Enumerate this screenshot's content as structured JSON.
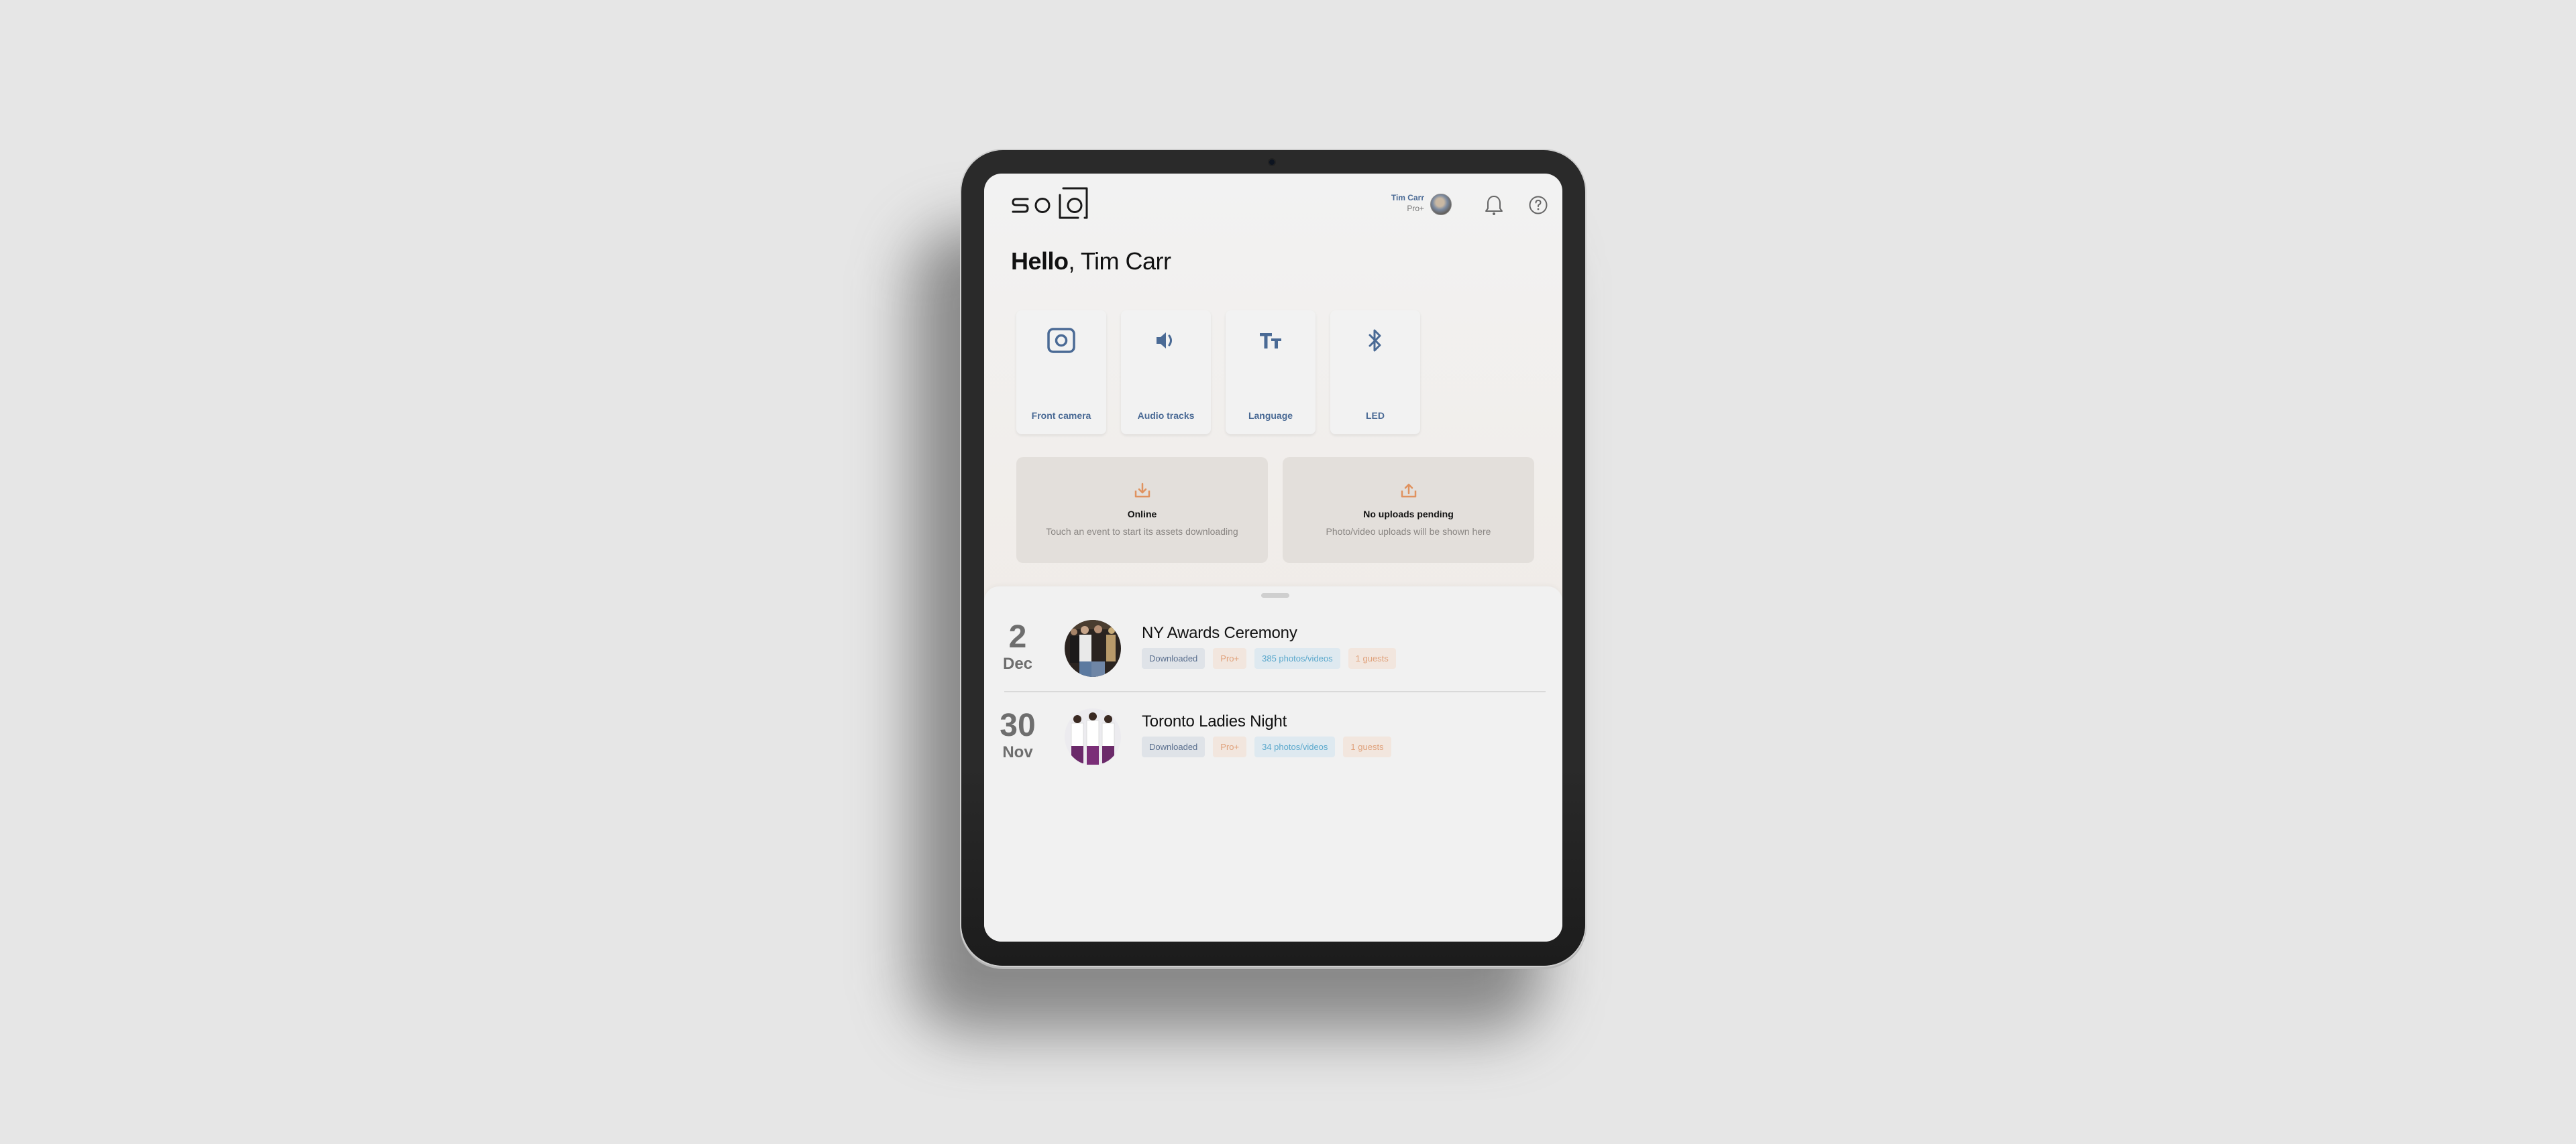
{
  "app": {
    "logo_text": "solo"
  },
  "header": {
    "user_name": "Tim Carr",
    "user_tier": "Pro+",
    "notifications_icon": "bell-icon",
    "help_icon": "help-circle-icon"
  },
  "greeting": {
    "hello": "Hello",
    "name": ", Tim Carr"
  },
  "quick_settings": [
    {
      "label": "Front camera",
      "icon": "camera-icon"
    },
    {
      "label": "Audio tracks",
      "icon": "speaker-icon"
    },
    {
      "label": "Language",
      "icon": "text-size-icon"
    },
    {
      "label": "LED",
      "icon": "bluetooth-icon"
    }
  ],
  "status_cards": [
    {
      "icon": "download-icon",
      "title": "Online",
      "subtitle": "Touch an event to start its assets downloading"
    },
    {
      "icon": "upload-icon",
      "title": "No uploads pending",
      "subtitle": "Photo/video uploads will be shown here"
    }
  ],
  "events": [
    {
      "day": "2",
      "month": "Dec",
      "name": "NY Awards Ceremony",
      "tags": {
        "status": "Downloaded",
        "tier": "Pro+",
        "media": "385 photos/videos",
        "guests": "1 guests"
      }
    },
    {
      "day": "30",
      "month": "Nov",
      "name": "Toronto Ladies Night",
      "tags": {
        "status": "Downloaded",
        "tier": "Pro+",
        "media": "34 photos/videos",
        "guests": "1 guests"
      }
    }
  ],
  "colors": {
    "accent_blue": "#4a6a95",
    "accent_orange": "#e0925f",
    "media_tag_text": "#5aa8cc"
  }
}
